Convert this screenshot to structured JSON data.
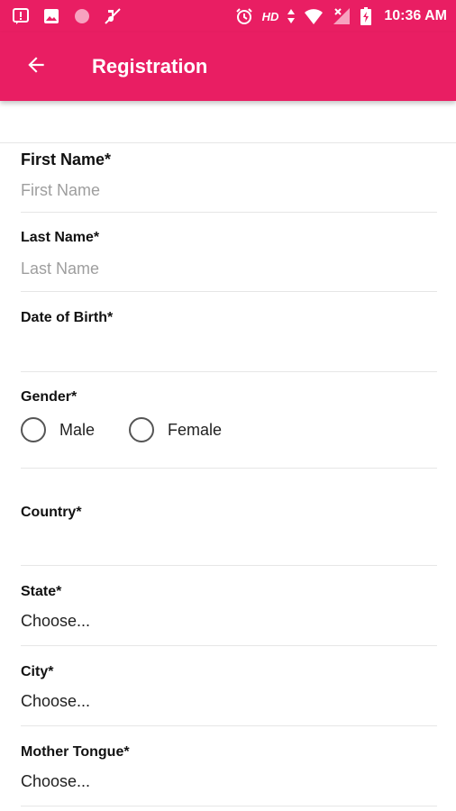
{
  "status_bar": {
    "hd": "HD",
    "time": "10:36 AM",
    "icons": [
      "alert-icon",
      "image-icon",
      "record-icon",
      "muted-icon",
      "alarm-icon",
      "data-arrows-icon",
      "wifi-icon",
      "no-signal-icon",
      "battery-charging-icon"
    ]
  },
  "toolbar": {
    "title": "Registration",
    "back_icon": "arrow-back-icon",
    "color": "#E91E63"
  },
  "form": {
    "first_name": {
      "label": "First Name*",
      "placeholder": "First Name",
      "value": ""
    },
    "last_name": {
      "label": "Last Name*",
      "placeholder": "Last Name",
      "value": ""
    },
    "dob": {
      "label": "Date of Birth*",
      "value": ""
    },
    "gender": {
      "label": "Gender*",
      "options": [
        "Male",
        "Female"
      ],
      "selected": ""
    },
    "country": {
      "label": "Country*",
      "value": ""
    },
    "state": {
      "label": "State*",
      "value": "Choose..."
    },
    "city": {
      "label": "City*",
      "value": "Choose..."
    },
    "mother_tongue": {
      "label": "Mother Tongue*",
      "value": "Choose..."
    }
  }
}
